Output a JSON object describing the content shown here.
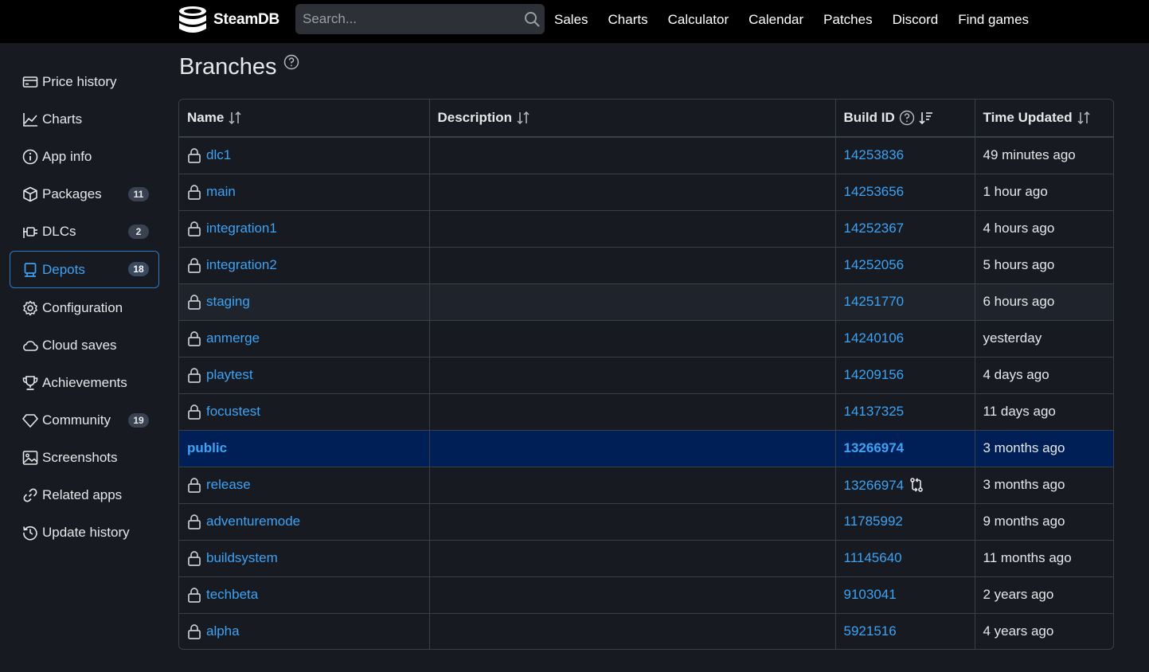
{
  "header": {
    "logo_text": "SteamDB",
    "search_placeholder": "Search...",
    "nav": [
      "Sales",
      "Charts",
      "Calculator",
      "Calendar",
      "Patches",
      "Discord",
      "Find games"
    ]
  },
  "sidebar": {
    "items": [
      {
        "label": "Price history",
        "icon": "price-history-icon",
        "badge": null,
        "active": false
      },
      {
        "label": "Charts",
        "icon": "chart-line-icon",
        "badge": null,
        "active": false
      },
      {
        "label": "App info",
        "icon": "info-icon",
        "badge": null,
        "active": false
      },
      {
        "label": "Packages",
        "icon": "package-icon",
        "badge": "11",
        "active": false
      },
      {
        "label": "DLCs",
        "icon": "plug-icon",
        "badge": "2",
        "active": false
      },
      {
        "label": "Depots",
        "icon": "server-icon",
        "badge": "18",
        "active": true
      },
      {
        "label": "Configuration",
        "icon": "gear-icon",
        "badge": null,
        "active": false
      },
      {
        "label": "Cloud saves",
        "icon": "cloud-icon",
        "badge": null,
        "active": false
      },
      {
        "label": "Achievements",
        "icon": "trophy-icon",
        "badge": null,
        "active": false
      },
      {
        "label": "Community",
        "icon": "diamond-icon",
        "badge": "19",
        "active": false
      },
      {
        "label": "Screenshots",
        "icon": "image-icon",
        "badge": null,
        "active": false
      },
      {
        "label": "Related apps",
        "icon": "link-icon",
        "badge": null,
        "active": false
      },
      {
        "label": "Update history",
        "icon": "history-icon",
        "badge": null,
        "active": false
      }
    ]
  },
  "main": {
    "title": "Branches",
    "columns": [
      "Name",
      "Description",
      "Build ID",
      "Time Updated"
    ],
    "rows": [
      {
        "name": "dlc1",
        "description": "",
        "build_id": "14253836",
        "time": "49 minutes ago",
        "locked": true,
        "public": false
      },
      {
        "name": "main",
        "description": "",
        "build_id": "14253656",
        "time": "1 hour ago",
        "locked": true,
        "public": false
      },
      {
        "name": "integration1",
        "description": "",
        "build_id": "14252367",
        "time": "4 hours ago",
        "locked": true,
        "public": false
      },
      {
        "name": "integration2",
        "description": "",
        "build_id": "14252056",
        "time": "5 hours ago",
        "locked": true,
        "public": false
      },
      {
        "name": "staging",
        "description": "",
        "build_id": "14251770",
        "time": "6 hours ago",
        "locked": true,
        "public": false,
        "hover": true
      },
      {
        "name": "anmerge",
        "description": "",
        "build_id": "14240106",
        "time": "yesterday",
        "locked": true,
        "public": false
      },
      {
        "name": "playtest",
        "description": "",
        "build_id": "14209156",
        "time": "4 days ago",
        "locked": true,
        "public": false
      },
      {
        "name": "focustest",
        "description": "",
        "build_id": "14137325",
        "time": "11 days ago",
        "locked": true,
        "public": false
      },
      {
        "name": "public",
        "description": "",
        "build_id": "13266974",
        "time": "3 months ago",
        "locked": false,
        "public": true
      },
      {
        "name": "release",
        "description": "",
        "build_id": "13266974",
        "time": "3 months ago",
        "locked": true,
        "public": false,
        "same_as_public": true
      },
      {
        "name": "adventuremode",
        "description": "",
        "build_id": "11785992",
        "time": "9 months ago",
        "locked": true,
        "public": false
      },
      {
        "name": "buildsystem",
        "description": "",
        "build_id": "11145640",
        "time": "11 months ago",
        "locked": true,
        "public": false
      },
      {
        "name": "techbeta",
        "description": "",
        "build_id": "9103041",
        "time": "2 years ago",
        "locked": true,
        "public": false
      },
      {
        "name": "alpha",
        "description": "",
        "build_id": "5921516",
        "time": "4 years ago",
        "locked": true,
        "public": false
      }
    ]
  },
  "colors": {
    "background": "#171a21",
    "topbar": "#000000",
    "link": "#3da3f4",
    "public_row": "#001f56",
    "border": "#3a3f48"
  }
}
